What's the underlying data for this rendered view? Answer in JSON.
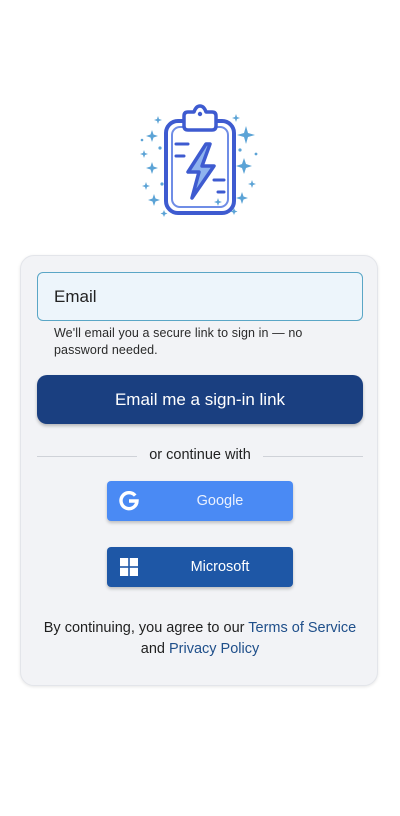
{
  "logo": {
    "icon": "clipboard-lightning-icon",
    "colors": {
      "primary": "#3e5bd0",
      "sparkle": "#5ba3d6"
    }
  },
  "form": {
    "email_placeholder": "Email",
    "helper_text": "We'll email you a secure link to sign in — no password needed.",
    "submit_label": "Email me a sign-in link",
    "divider_text": "or continue with"
  },
  "social": {
    "google_label": "Google",
    "google_icon": "google-g-icon",
    "microsoft_label": "Microsoft",
    "microsoft_icon": "windows-logo-icon"
  },
  "legal": {
    "prefix": "By continuing, you agree to our ",
    "terms_link": "Terms of Service",
    "conjunction": " and ",
    "privacy_link": "Privacy Policy"
  },
  "colors": {
    "primary_button": "#1a3f80",
    "google_button": "#4a8af4",
    "microsoft_button": "#1e57a6",
    "link": "#1f4f8a",
    "input_border": "#5aa6c6"
  }
}
